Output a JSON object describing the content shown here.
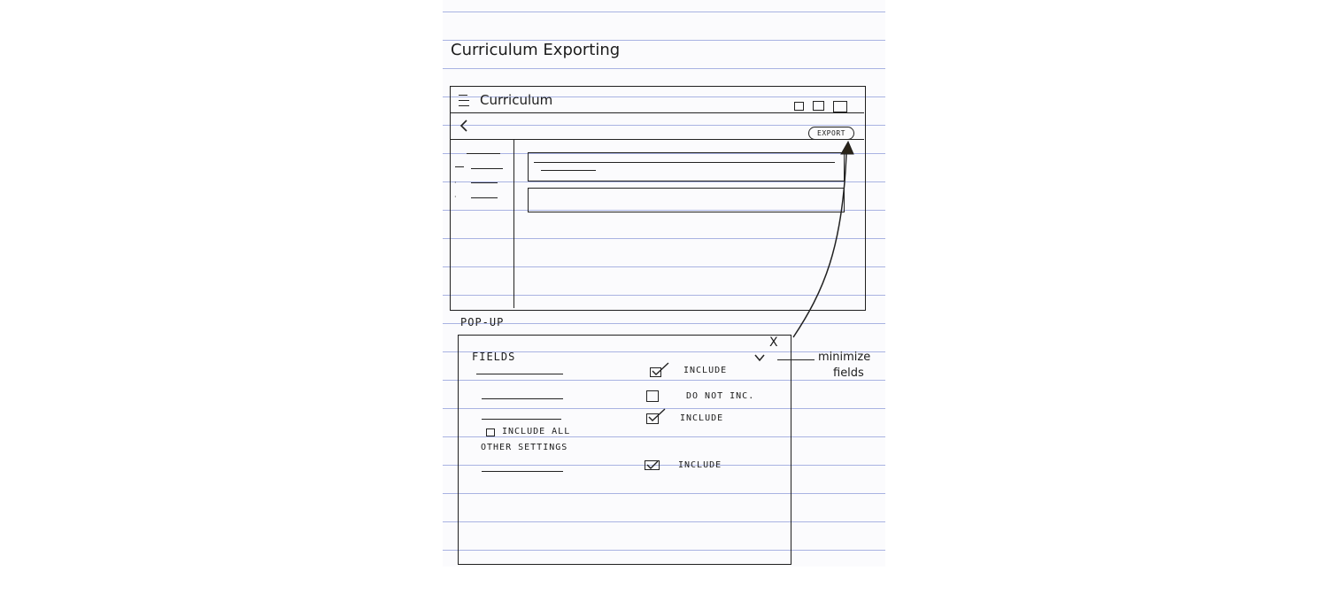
{
  "sketch": {
    "title": "Curriculum Exporting",
    "popup_caption": "POP-UP",
    "annotation": {
      "line1": "minimize",
      "line2": "fields"
    }
  },
  "app_window": {
    "title": "Curriculum",
    "menu_icon": "hamburger-menu-icon",
    "back_icon": "chevron-left-icon",
    "export_label": "EXPORT"
  },
  "popup": {
    "close_label": "X",
    "collapse_icon": "chevron-down-icon",
    "fields_heading": "FIELDS",
    "field_rows": [
      {
        "option": "INCLUDE",
        "checked": true
      },
      {
        "option": "DO NOT INC.",
        "checked": false
      },
      {
        "option": "INCLUDE",
        "checked": true
      }
    ],
    "include_all_label": "INCLUDE ALL",
    "other_settings_heading": "OTHER SETTINGS",
    "setting_rows": [
      {
        "option": "INCLUDE",
        "checked": true
      }
    ]
  },
  "colors": {
    "ink": "#1c1c1c",
    "ruled_line": "#a9b3e2",
    "paper": "#fbfbfd"
  }
}
